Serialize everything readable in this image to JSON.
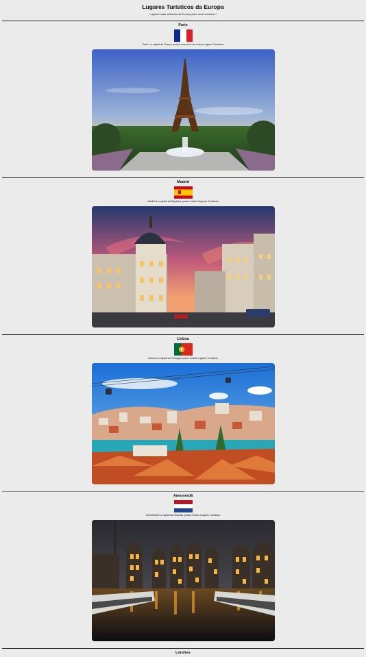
{
  "page": {
    "title": "Lugares Turísticos da Europa",
    "subtitle": "Lugares mais visitados da Europa para você conhecer!"
  },
  "places": [
    {
      "city": "Paris",
      "description": "Paris é a capital da França, possui uma série de muitos Lugares Turísticos"
    },
    {
      "city": "Madrid",
      "description": "Madrid é a capital da Espanha, possui muitos Lugares Turísticos"
    },
    {
      "city": "Lisboa",
      "description": "Lisboa é a capital de Portugal, possui muitos Lugares Turísticos"
    },
    {
      "city": "Amesterdã",
      "description": "Amesterdã é a capital da Holanda, possui muitos Lugares Turísticos"
    },
    {
      "city": "Londres"
    }
  ],
  "flags": {
    "france": [
      "#0a2b8f",
      "#ffffff",
      "#d8232a"
    ],
    "spain": [
      "#c60b1e",
      "#ffc400"
    ],
    "portugal": [
      "#046a38",
      "#da291c"
    ],
    "netherlands": [
      "#ae1c28",
      "#ffffff",
      "#21468b"
    ]
  }
}
